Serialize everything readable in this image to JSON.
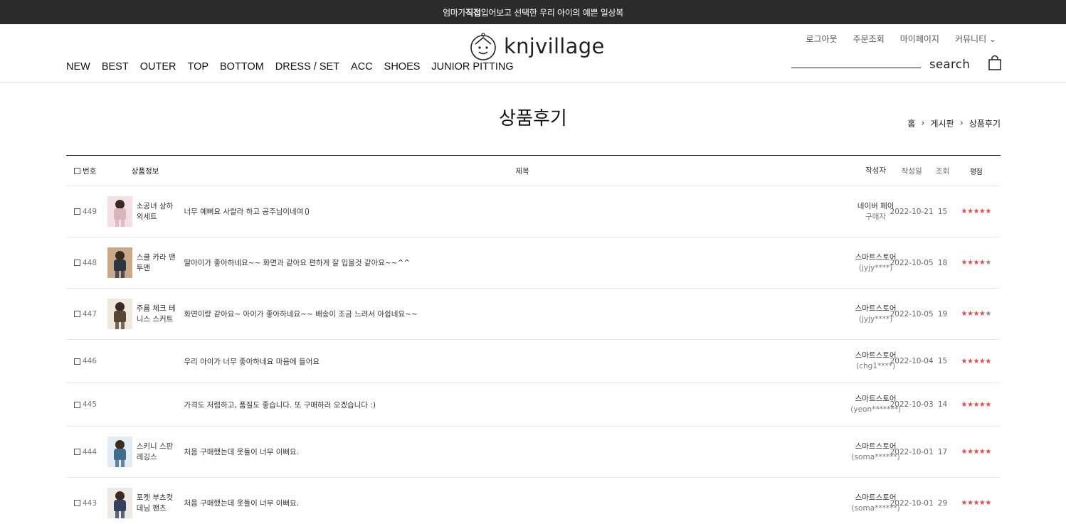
{
  "promo": {
    "pre": "엄마가 ",
    "bold": "직접",
    "post": " 입어보고 선택한 우리 아이의 예쁜 일상복"
  },
  "logo": {
    "text": "knjvillage"
  },
  "gnb": [
    "NEW",
    "BEST",
    "OUTER",
    "TOP",
    "BOTTOM",
    "DRESS / SET",
    "ACC",
    "SHOES",
    "JUNIOR PITTING"
  ],
  "util": [
    "로그아웃",
    "주문조회",
    "마이페이지",
    "커뮤니티 ⌄"
  ],
  "search": {
    "label": "search",
    "value": ""
  },
  "page": {
    "title": "상품후기"
  },
  "breadcrumb": [
    "홈",
    "게시판",
    "상품후기"
  ],
  "table": {
    "headers": {
      "no": "번호",
      "product": "상품정보",
      "subject": "제목",
      "writer": "작성자",
      "date": "작성일",
      "hit": "조회",
      "rating": "평점"
    },
    "rows": [
      {
        "no": "449",
        "product": "소공녀 상하의세트",
        "thumb": [
          "#f3dfe4",
          "#d9b3bd"
        ],
        "subject": "너무 예뻐요 사랄라 하고 공주님이네여",
        "attach": true,
        "writer": "네이버 페이",
        "writer_id": "구매자",
        "date": "2022-10-21",
        "hit": "15",
        "rating": 5
      },
      {
        "no": "448",
        "product": "스쿨 카라 맨투맨",
        "thumb": [
          "#c9a98a",
          "#2f3440"
        ],
        "subject": "딸아이가 좋아하네요~~ 화면과 같아요 편하게 잘 입을것 같아요~~^^",
        "attach": false,
        "writer": "스마트스토어",
        "writer_id": "(jyjy****)",
        "date": "2022-10-05",
        "hit": "18",
        "rating": 4
      },
      {
        "no": "447",
        "product": "주름 체크 테니스 스커트",
        "thumb": [
          "#efe8de",
          "#5a4535"
        ],
        "subject": "화면이랑 같아요~ 아이가 좋아하네요~~ 배송이 조금 느려서 아쉽네요~~",
        "attach": false,
        "writer": "스마트스토어",
        "writer_id": "(jyjy****)",
        "date": "2022-10-05",
        "hit": "19",
        "rating": 4
      },
      {
        "no": "446",
        "product": "",
        "thumb": null,
        "subject": "우리 아이가 너무 좋아하네요 마음에 들어요",
        "attach": false,
        "writer": "스마트스토어",
        "writer_id": "(chg1****)",
        "date": "2022-10-04",
        "hit": "15",
        "rating": 5
      },
      {
        "no": "445",
        "product": "",
        "thumb": null,
        "subject": "가격도 저렴하고, 품질도 좋습니다. 또 구매하러 오겠습니다 :)",
        "attach": false,
        "writer": "스마트스토어",
        "writer_id": "(yeon*******)",
        "date": "2022-10-03",
        "hit": "14",
        "rating": 5
      },
      {
        "no": "444",
        "product": "스키니 스판 레깅스",
        "thumb": [
          "#e3ecf0",
          "#3d6d8a"
        ],
        "subject": "처음 구매했는데 옷들이 너무 이뻐요.",
        "attach": false,
        "writer": "스마트스토어",
        "writer_id": "(soma******)",
        "date": "2022-10-01",
        "hit": "17",
        "rating": 5
      },
      {
        "no": "443",
        "product": "포켓 부츠컷 데님 팬츠",
        "thumb": [
          "#eee9e4",
          "#34415c"
        ],
        "subject": "처음 구매했는데 옷들이 너무 이뻐요.",
        "attach": false,
        "writer": "스마트스토어",
        "writer_id": "(soma******)",
        "date": "2022-10-01",
        "hit": "29",
        "rating": 5
      }
    ]
  },
  "colors": {
    "promo_bg": "#2b2b2b",
    "star": "#e8474c",
    "star_off": "#888888"
  }
}
